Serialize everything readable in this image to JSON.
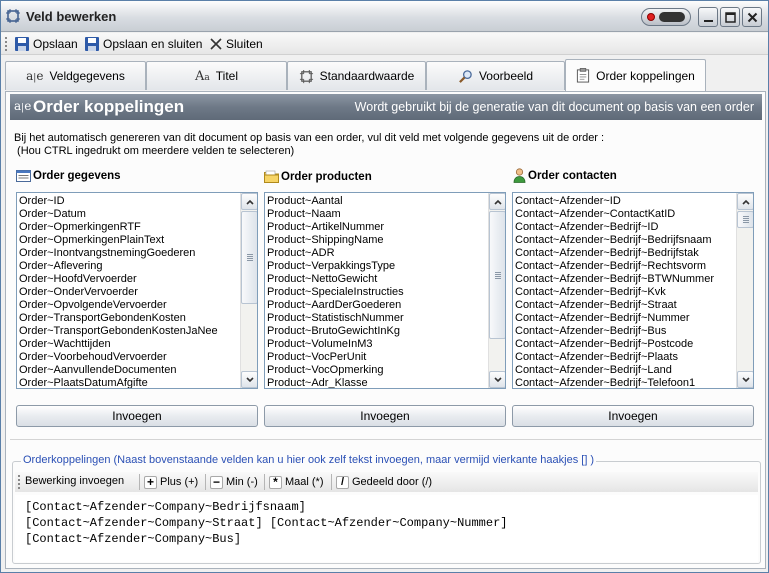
{
  "window": {
    "title": "Veld bewerken",
    "controls": {
      "minimize": "minimize",
      "maximize": "maximize",
      "close": "close"
    }
  },
  "toolbar": {
    "save_label": "Opslaan",
    "save_close_label": "Opslaan en sluiten",
    "close_label": "Sluiten"
  },
  "tabs": [
    {
      "label": "Veldgegevens",
      "icon": "field-data-icon"
    },
    {
      "label": "Titel",
      "icon": "text-font-icon"
    },
    {
      "label": "Standaardwaarde",
      "icon": "default-value-icon"
    },
    {
      "label": "Voorbeeld",
      "icon": "magnifier-icon"
    },
    {
      "label": "Order koppelingen",
      "icon": "clipboard-icon",
      "active": true
    }
  ],
  "header": {
    "title": "Order koppelingen",
    "subtitle": "Wordt gebruikt bij de generatie van dit document op basis van een order"
  },
  "intro": {
    "line1": "Bij het automatisch genereren van dit document op basis van een order, vul dit veld met volgende gegevens uit de order :",
    "line2": " (Hou CTRL ingedrukt om meerdere velden te selecteren)"
  },
  "columns": [
    {
      "heading": "Order gegevens",
      "icon": "form-icon",
      "items": [
        "Order~ID",
        "Order~Datum",
        "Order~OpmerkingenRTF",
        "Order~OpmerkingenPlainText",
        "Order~InontvangstnemingGoederen",
        "Order~Aflevering",
        "Order~HoofdVervoerder",
        "Order~OnderVervoerder",
        "Order~OpvolgendeVervoerder",
        "Order~TransportGebondenKosten",
        "Order~TransportGebondenKostenJaNee",
        "Order~Wachttijden",
        "Order~VoorbehoudVervoerder",
        "Order~AanvullendeDocumenten",
        "Order~PlaatsDatumAfgifte"
      ],
      "insert_label": "Invoegen"
    },
    {
      "heading": "Order producten",
      "icon": "folder-icon",
      "items": [
        "Product~Aantal",
        "Product~Naam",
        "Product~ArtikelNummer",
        "Product~ShippingName",
        "Product~ADR",
        "Product~VerpakkingsType",
        "Product~NettoGewicht",
        "Product~SpecialeInstructies",
        "Product~AardDerGoederen",
        "Product~StatistischNummer",
        "Product~BrutoGewichtInKg",
        "Product~VolumeInM3",
        "Product~VocPerUnit",
        "Product~VocOpmerking",
        "Product~Adr_Klasse"
      ],
      "insert_label": "Invoegen"
    },
    {
      "heading": "Order contacten",
      "icon": "person-icon",
      "items": [
        "Contact~Afzender~ID",
        "Contact~Afzender~ContactKatID",
        "Contact~Afzender~Bedrijf~ID",
        "Contact~Afzender~Bedrijf~Bedrijfsnaam",
        "Contact~Afzender~Bedrijf~Bedrijfstak",
        "Contact~Afzender~Bedrijf~Rechtsvorm",
        "Contact~Afzender~Bedrijf~BTWNummer",
        "Contact~Afzender~Bedrijf~Kvk",
        "Contact~Afzender~Bedrijf~Straat",
        "Contact~Afzender~Bedrijf~Nummer",
        "Contact~Afzender~Bedrijf~Bus",
        "Contact~Afzender~Bedrijf~Postcode",
        "Contact~Afzender~Bedrijf~Plaats",
        "Contact~Afzender~Bedrijf~Land",
        "Contact~Afzender~Bedrijf~Telefoon1"
      ],
      "insert_label": "Invoegen"
    }
  ],
  "orderkoppelingen": {
    "legend": "Orderkoppelingen (Naast bovenstaande velden kan u hier ook zelf tekst invoegen, maar vermijd vierkante haakjes [] )",
    "toolbar_label": "Bewerking invoegen",
    "ops": [
      {
        "label": "Plus (+)",
        "glyph": "+"
      },
      {
        "label": "Min (-)",
        "glyph": "−"
      },
      {
        "label": "Maal (*)",
        "glyph": "*"
      },
      {
        "label": "Gedeeld door (/)",
        "glyph": "/"
      }
    ],
    "lines": [
      "[Contact~Afzender~Company~Bedrijfsnaam]",
      "[Contact~Afzender~Company~Straat] [Contact~Afzender~Company~Nummer]",
      "[Contact~Afzender~Company~Bus]"
    ]
  }
}
